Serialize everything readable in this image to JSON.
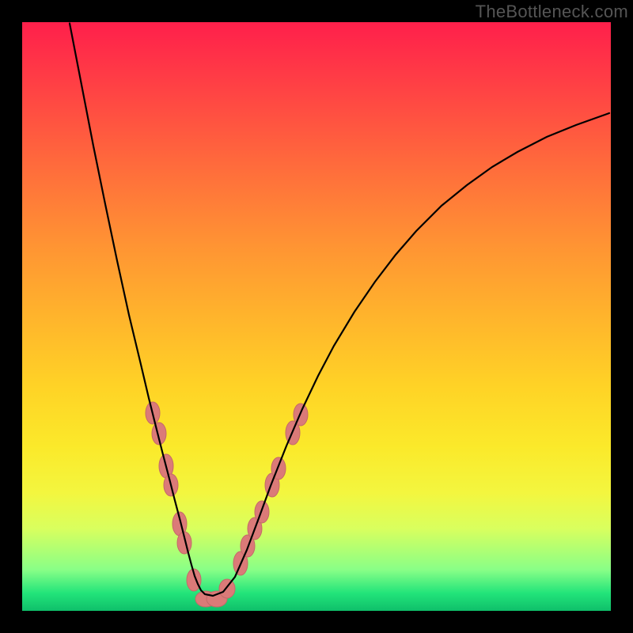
{
  "watermark": "TheBottleneck.com",
  "colors": {
    "frame_bg_top": "#ff1f4b",
    "frame_bg_bottom": "#0fbf6a",
    "curve": "#000000",
    "blob_fill": "#db7a78",
    "blob_stroke": "#c46a68",
    "page_bg": "#000000"
  },
  "chart_data": {
    "type": "line",
    "title": "",
    "xlabel": "",
    "ylabel": "",
    "xlim": [
      0,
      100
    ],
    "ylim": [
      0,
      100
    ],
    "grid": false,
    "legend": false,
    "note": "Axis values are normalized 0–100 because the source image has no numeric axis labels. x is horizontal position (0=left edge of gradient frame, 100=right). y is vertical position (0=bottom, 100=top). Curve traced from pixels.",
    "series": [
      {
        "name": "curve",
        "x": [
          8.06,
          10.08,
          12.1,
          14.11,
          16.13,
          18.15,
          20.16,
          21.51,
          22.85,
          23.92,
          25.0,
          25.94,
          26.88,
          27.55,
          28.23,
          28.76,
          29.3,
          29.84,
          30.38,
          31.05,
          32.39,
          34.14,
          36.16,
          38.17,
          40.19,
          42.2,
          44.89,
          47.58,
          50.27,
          52.96,
          56.45,
          59.95,
          63.44,
          66.94,
          71.24,
          75.54,
          79.84,
          84.14,
          89.11,
          94.09,
          99.73
        ],
        "y": [
          99.8,
          89.38,
          78.97,
          69.09,
          59.48,
          50.27,
          41.87,
          36.16,
          30.78,
          26.55,
          22.45,
          18.75,
          15.19,
          12.5,
          9.81,
          7.8,
          5.91,
          4.57,
          3.49,
          2.82,
          2.55,
          3.23,
          5.78,
          10.35,
          15.73,
          21.24,
          28.02,
          34.27,
          39.92,
          45.03,
          50.81,
          55.91,
          60.48,
          64.52,
          68.82,
          72.31,
          75.4,
          77.96,
          80.51,
          82.53,
          84.54
        ]
      }
    ],
    "markers": {
      "name": "highlighted-points",
      "color": "#db7a78",
      "points": [
        {
          "x": 22.18,
          "y": 33.6
        },
        {
          "x": 23.25,
          "y": 30.11
        },
        {
          "x": 24.46,
          "y": 24.6
        },
        {
          "x": 25.27,
          "y": 21.37
        },
        {
          "x": 26.75,
          "y": 14.78
        },
        {
          "x": 27.55,
          "y": 11.56
        },
        {
          "x": 29.17,
          "y": 5.24
        },
        {
          "x": 31.18,
          "y": 2.02
        },
        {
          "x": 33.06,
          "y": 2.02
        },
        {
          "x": 34.81,
          "y": 3.76
        },
        {
          "x": 37.1,
          "y": 8.06
        },
        {
          "x": 38.31,
          "y": 11.02
        },
        {
          "x": 39.52,
          "y": 13.98
        },
        {
          "x": 40.73,
          "y": 16.8
        },
        {
          "x": 42.47,
          "y": 21.37
        },
        {
          "x": 43.55,
          "y": 24.19
        },
        {
          "x": 45.97,
          "y": 30.24
        },
        {
          "x": 47.31,
          "y": 33.33
        }
      ]
    }
  }
}
